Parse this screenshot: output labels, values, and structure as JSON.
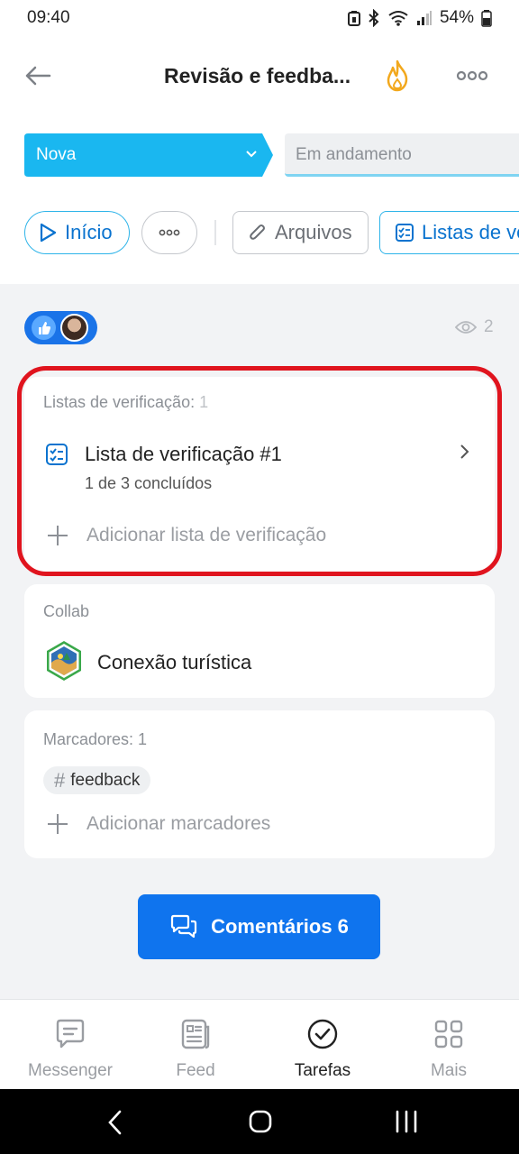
{
  "status_bar": {
    "time": "09:40",
    "battery": "54%",
    "icons": [
      "silent-icon",
      "bluetooth-icon",
      "wifi-icon",
      "signal-icon",
      "battery-icon"
    ]
  },
  "header": {
    "title": "Revisão e feedba...",
    "icons": {
      "back": "arrow-left-icon",
      "fire": "flame-icon",
      "more": "ellipsis-icon"
    },
    "accent_color": "#f2a81d"
  },
  "stages": {
    "current": "Nova",
    "next": "Em andamento",
    "current_color": "#1ab7f0"
  },
  "actions": {
    "start": "Início",
    "files": "Arquivos",
    "checklists": "Listas de ve"
  },
  "reactions": {
    "views": "2"
  },
  "checklist_card": {
    "label": "Listas de verificação:",
    "count": "1",
    "item_title": "Lista de verificação #1",
    "item_progress": "1 de 3 concluídos",
    "add_label": "Adicionar lista de verificação"
  },
  "collab_card": {
    "label": "Collab",
    "name": "Conexão turística"
  },
  "tags_card": {
    "label": "Marcadores: 1",
    "tag": "feedback",
    "add_label": "Adicionar marcadores"
  },
  "comments_button": {
    "label": "Comentários 6"
  },
  "bottom_nav": {
    "items": [
      {
        "label": "Messenger",
        "icon": "chat-icon"
      },
      {
        "label": "Feed",
        "icon": "feed-icon"
      },
      {
        "label": "Tarefas",
        "icon": "check-circle-icon"
      },
      {
        "label": "Mais",
        "icon": "grid-icon"
      }
    ],
    "active": "Tarefas"
  },
  "highlight_color": "#e0141e"
}
